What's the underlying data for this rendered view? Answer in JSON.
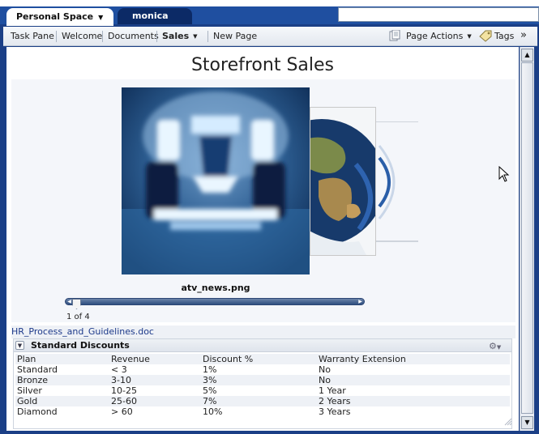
{
  "tabs": {
    "personal_space": "Personal Space",
    "monica": "monica"
  },
  "nav": {
    "task_pane": "Task Pane",
    "welcome": "Welcome",
    "documents": "Documents",
    "sales": "Sales",
    "new_page": "New Page",
    "page_actions": "Page Actions",
    "tags": "Tags",
    "more": "»"
  },
  "page": {
    "title": "Storefront Sales"
  },
  "viewer": {
    "caption": "atv_news.png",
    "counter": "1 of 4",
    "current": 1,
    "total": 4
  },
  "document_link": "HR_Process_and_Guidelines.doc",
  "discounts": {
    "title": "Standard Discounts",
    "columns": [
      "Plan",
      "Revenue",
      "Discount %",
      "Warranty Extension"
    ],
    "rows": [
      [
        "Standard",
        "< 3",
        "1%",
        "No"
      ],
      [
        "Bronze",
        "3-10",
        "3%",
        "No"
      ],
      [
        "Silver",
        "10-25",
        "5%",
        "1 Year"
      ],
      [
        "Gold",
        "25-60",
        "7%",
        "2 Years"
      ],
      [
        "Diamond",
        "> 60",
        "10%",
        "3 Years"
      ]
    ]
  },
  "colors": {
    "brand_blue": "#1f4fa0",
    "link_blue": "#1d3a8a"
  }
}
